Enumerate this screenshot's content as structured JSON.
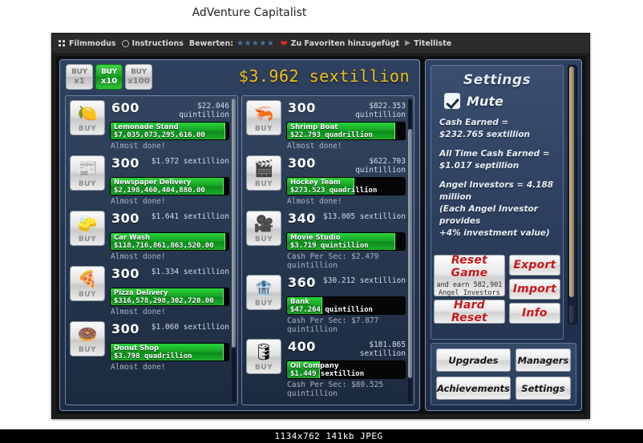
{
  "page": {
    "title": "AdVenture Capitalist"
  },
  "statusbar": {
    "text": "1134x762  141kb  JPEG"
  },
  "kong_bar": {
    "film_mode": "Filmmodus",
    "instructions": "Instructions",
    "rate_label": "Bewerten:",
    "stars": "★★★★★",
    "favorite": "Zu Favoriten hinzugefügt",
    "title_list": "Titelliste"
  },
  "game": {
    "cash": "$3.962 sextillion",
    "buy_multipliers": [
      {
        "top": "BUY",
        "bottom": "x1",
        "active": false,
        "name": "buy-x1"
      },
      {
        "top": "BUY",
        "bottom": "x10",
        "active": true,
        "name": "buy-x10"
      },
      {
        "top": "BUY",
        "bottom": "x100",
        "active": false,
        "name": "buy-x100"
      }
    ],
    "buy_label": "BUY",
    "businesses_left": [
      {
        "name": "Lemonade Stand",
        "icon": "lemon-icon",
        "glyph": "🍋",
        "qty": "600",
        "price": "$22.046\nquintillion",
        "value": "$7,035,073,295,616.00",
        "progress": 97,
        "footer": "Almost done!"
      },
      {
        "name": "Newspaper Delivery",
        "icon": "newspaper-icon",
        "glyph": "📰",
        "qty": "300",
        "price": "$1.972 sextillion",
        "value": "$2,198,460,404,880.00",
        "progress": 96,
        "footer": "Almost done!"
      },
      {
        "name": "Car Wash",
        "icon": "car-wash-icon",
        "glyph": "🧽",
        "qty": "300",
        "price": "$1.641 sextillion",
        "value": "$118,716,861,863,520.00",
        "progress": 97,
        "footer": "Almost done!"
      },
      {
        "name": "Pizza Delivery",
        "icon": "pizza-icon",
        "glyph": "🍕",
        "qty": "300",
        "price": "$1.334 sextillion",
        "value": "$316,578,298,302,720.00",
        "progress": 96,
        "footer": "Almost done!"
      },
      {
        "name": "Donut Shop",
        "icon": "donut-icon",
        "glyph": "🍩",
        "qty": "300",
        "price": "$1.060 sextillion",
        "value": "$3.798 quadrillion",
        "progress": 96,
        "footer": "Almost done!"
      }
    ],
    "businesses_right": [
      {
        "name": "Shrimp Boat",
        "icon": "shrimp-icon",
        "glyph": "🦐",
        "qty": "300",
        "price": "$822.353\nquintillion",
        "value": "$22.793 quadrillion",
        "progress": 92,
        "footer": "Almost done!"
      },
      {
        "name": "Hockey Team",
        "icon": "clapperboard-icon",
        "glyph": "🎬",
        "qty": "300",
        "price": "$622.703\nquintillion",
        "value": "$273.523 quadrillion",
        "progress": 57,
        "footer": "Almost done!"
      },
      {
        "name": "Movie Studio",
        "icon": "movie-camera-icon",
        "glyph": "🎥",
        "qty": "340",
        "price": "$13.005 sextillion",
        "value": "$3.719 quintillion",
        "progress": 92,
        "footer": "Cash Per Sec: $2.479 quintillion"
      },
      {
        "name": "Bank",
        "icon": "bank-icon",
        "glyph": "🏦",
        "qty": "360",
        "price": "$30.212 sextillion",
        "value": "$47.264 quintillion",
        "progress": 30,
        "footer": "Cash Per Sec: $7.877 quintillion"
      },
      {
        "name": "Oil Company",
        "icon": "oil-derrick-icon",
        "glyph": "🛢",
        "qty": "400",
        "price": "$181.865\nsextillion",
        "value": "$1.449 sextillion",
        "progress": 28,
        "footer": "Cash Per Sec: $80.525 quintillion"
      }
    ]
  },
  "settings": {
    "title": "Settings",
    "mute_label": "Mute",
    "mute_checked": true,
    "stats": [
      {
        "line1": "Cash Earned =",
        "line2": "$232.765 sextillion"
      },
      {
        "line1": "All Time Cash Earned =",
        "line2": "$1.017 septillion"
      },
      {
        "line1": "Angel Investors = 4.188 million",
        "line2": "(Each Angel Investor provides"
      },
      {
        "line1": "+4% investment value)",
        "line2": ""
      }
    ],
    "reset_game": {
      "label": "Reset Game",
      "sub_line1": "and earn 582,901",
      "sub_line2": "Angel Investors"
    },
    "hard_reset": "Hard Reset",
    "export": "Export",
    "import": "Import",
    "info": "Info",
    "nav": [
      "Upgrades",
      "Managers",
      "Achievements",
      "Settings"
    ]
  },
  "colors": {
    "cash_yellow": "#f2c11c",
    "progress_green": "#17a526",
    "reset_red": "#c8171a",
    "panel_blue": "#2b3e5c"
  }
}
